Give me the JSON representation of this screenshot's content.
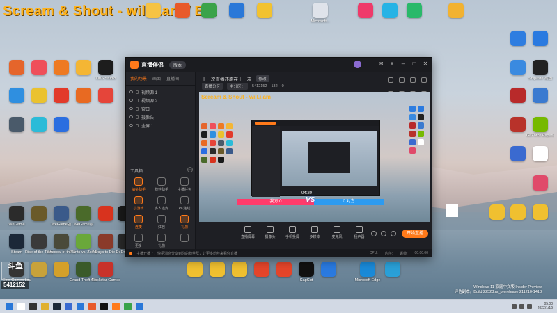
{
  "overlay_title": "Scream & Shout - will.i.am / B...",
  "desktop_icons_top": [
    {
      "label": "",
      "color": "#f6c344"
    },
    {
      "label": "",
      "color": "#e85a2a"
    },
    {
      "label": "",
      "color": "#3aa34a"
    },
    {
      "label": "",
      "color": "#2a78d8"
    },
    {
      "label": "",
      "color": "#f2c230"
    },
    {
      "label": "Microsoft...",
      "color": "#dfe3ea"
    },
    {
      "label": "",
      "color": "#ef3a6a"
    },
    {
      "label": "",
      "color": "#27b3e5"
    },
    {
      "label": "",
      "color": "#29b96a"
    },
    {
      "label": "",
      "color": "#f2b230"
    }
  ],
  "desktop_icons_left": [
    {
      "label": "",
      "color": "#e5652b"
    },
    {
      "label": "",
      "color": "#ef4f5a"
    },
    {
      "label": "",
      "color": "#ee7a22"
    },
    {
      "label": "",
      "color": "#f4b634"
    },
    {
      "label": "OBS Studio",
      "color": "#1d1d1d"
    },
    {
      "label": "",
      "color": "#2f8fe0"
    },
    {
      "label": "",
      "color": "#eac22f"
    },
    {
      "label": "",
      "color": "#e23a2a"
    },
    {
      "label": "",
      "color": "#e86a22"
    },
    {
      "label": "",
      "color": "#e5453a"
    },
    {
      "label": "",
      "color": "#4a5a6a"
    },
    {
      "label": "",
      "color": "#2bbbd8"
    },
    {
      "label": "",
      "color": "#2b6ee0"
    }
  ],
  "desktop_icons_row3": [
    {
      "label": "WeGame",
      "color": "#2b2b2b"
    },
    {
      "label": "",
      "color": "#6a5a2a"
    },
    {
      "label": "WeGame版",
      "color": "#3a5a8a"
    },
    {
      "label": "WeGame版",
      "color": "#4a6a2a"
    },
    {
      "label": "",
      "color": "#d8331e"
    },
    {
      "label": "",
      "color": "#1a1a1a"
    }
  ],
  "desktop_icons_row4": [
    {
      "label": "Steam",
      "color": "#1b2838"
    },
    {
      "label": "Rise of the Tomb Rai...",
      "color": "#3a3a3a"
    },
    {
      "label": "Shadow of the Tomb...",
      "color": "#4a4a3a"
    },
    {
      "label": "Plants vs. Zombies G...",
      "color": "#6aa83a"
    },
    {
      "label": "7 Days to Die Dedi...",
      "color": "#8a3a2a"
    },
    {
      "label": "Draw",
      "color": "#2a2a2a"
    }
  ],
  "desktop_icons_row5": [
    {
      "label": "Epic Games Launcher",
      "color": "#111111"
    },
    {
      "label": "",
      "color": "#c8a23a"
    },
    {
      "label": "",
      "color": "#d4a02a"
    },
    {
      "label": "Grand Theft Auto V",
      "color": "#3a5a2a"
    },
    {
      "label": "Rockstar Games...",
      "color": "#c8322a"
    }
  ],
  "desktop_icons_right": [
    {
      "label": "",
      "color": "#2e7de0"
    },
    {
      "label": "",
      "color": "#2a7ae0"
    },
    {
      "label": "",
      "color": "#3a8ae0"
    },
    {
      "label": "Snipaste 截图",
      "color": "#222222"
    },
    {
      "label": "",
      "color": "#b82a2a"
    },
    {
      "label": "",
      "color": "#3a7ad0"
    },
    {
      "label": "",
      "color": "#b8322a"
    },
    {
      "label": "GeForce Experience",
      "color": "#76b900"
    },
    {
      "label": "",
      "color": "#3a6ad0"
    },
    {
      "label": "",
      "color": "#ffffff"
    },
    {
      "label": "",
      "color": "#e04a6a"
    }
  ],
  "desktop_icons_mid_right": [
    {
      "label": "",
      "color": "#f0c030"
    },
    {
      "label": "",
      "color": "#f0c030"
    },
    {
      "label": "",
      "color": "#f0c030"
    }
  ],
  "desktop_icons_bottom_row": [
    {
      "label": "",
      "color": "#f0c030"
    },
    {
      "label": "",
      "color": "#f0c030"
    },
    {
      "label": "",
      "color": "#f0c030"
    },
    {
      "label": "",
      "color": "#e5452a"
    },
    {
      "label": "",
      "color": "#e5452a"
    },
    {
      "label": "CapCut",
      "color": "#111111"
    },
    {
      "label": "",
      "color": "#2a7ae0"
    },
    {
      "label": "Microsoft Edge",
      "color": "#1a8ad8"
    },
    {
      "label": "",
      "color": "#2aa0d8"
    }
  ],
  "app": {
    "name": "直播伴侣",
    "version_btn": "版本",
    "tabs": [
      "我的场景",
      "画面",
      "直播间"
    ],
    "scenes": [
      "视频源 1",
      "视频源 2",
      "窗口",
      "摄像头",
      "全屏 1"
    ],
    "tools_title": "工具箱",
    "tools_more": "···",
    "tools": [
      {
        "label": "抽奖助手",
        "active": true
      },
      {
        "label": "粉丝助手",
        "active": false
      },
      {
        "label": "主播任务",
        "active": false
      },
      {
        "label": "小游戏",
        "active": true
      },
      {
        "label": "多人连麦",
        "active": false
      },
      {
        "label": "PK连线",
        "active": false
      },
      {
        "label": "连麦",
        "active": true
      },
      {
        "label": "红包",
        "active": false
      },
      {
        "label": "礼物",
        "active": true
      },
      {
        "label": "更多",
        "active": false
      },
      {
        "label": "礼物",
        "active": false
      },
      {
        "label": "",
        "active": false
      }
    ],
    "live_title": "上一次直播还原在上一次",
    "edit_label": "修改",
    "meta": [
      "直播分区",
      "主分区：",
      "5412152",
      "132",
      "0"
    ],
    "preview_title": "Scream & Shout - will.i.am",
    "pk_left": "我方 0",
    "pk_right": "0 对方",
    "pk_vs": "VS",
    "pk_timer": "04:20",
    "bottom_tools": [
      "直播屏幕",
      "摄像头",
      "手机投屏",
      "多媒体",
      "麦克风",
      "扬声器"
    ],
    "go_live": "开始直播",
    "status_text": "主播开播了，快把消息分享到你的粉丝群，让更多粉丝来看你直播",
    "status_right": [
      "CPU:",
      "内存:",
      "丢帧:",
      "00:00:00"
    ]
  },
  "watermark": {
    "logo": "斗鱼",
    "id": "5412152"
  },
  "windows_eval": {
    "line1": "Windows 11 家庭中文版 Insider Preview",
    "line2": "评估副本。Build 22523.rs_prerelease.211210-1418"
  },
  "taskbar": {
    "icons": [
      {
        "color": "#2a78d8"
      },
      {
        "color": "#ffffff"
      },
      {
        "color": "#333333"
      },
      {
        "color": "#e0b030"
      },
      {
        "color": "#1b2838"
      },
      {
        "color": "#3a6ad0"
      },
      {
        "color": "#2a78d8"
      },
      {
        "color": "#e85a2a"
      },
      {
        "color": "#111111"
      },
      {
        "color": "#ff7a1a"
      },
      {
        "color": "#3aa34a"
      },
      {
        "color": "#2a78d8"
      }
    ],
    "time": "05:00",
    "date": "2022/1/16"
  }
}
